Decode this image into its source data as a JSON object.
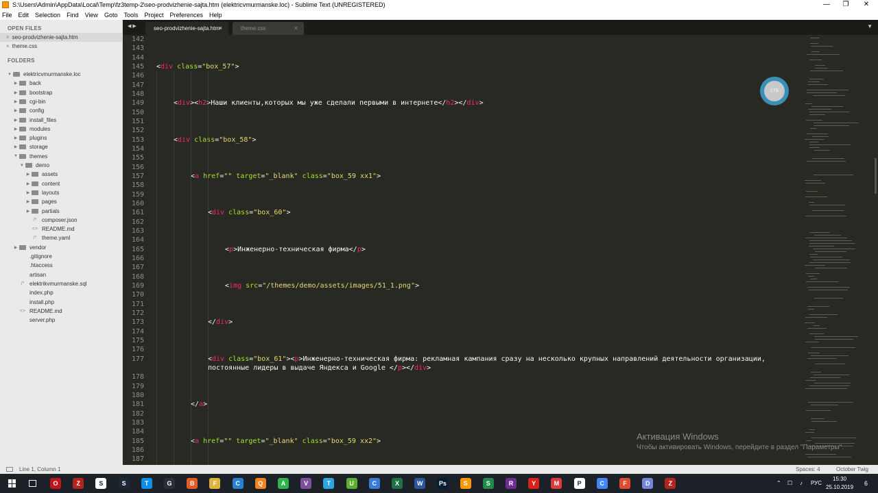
{
  "window": {
    "title": "S:\\Users\\Admin\\AppData\\Local\\Temp\\fz3temp-2\\seo-prodvizhenie-sajta.htm (elektricvmurmanske.loc) - Sublime Text (UNREGISTERED)",
    "minimize": "—",
    "maximize": "❐",
    "close": "✕"
  },
  "menu": [
    "File",
    "Edit",
    "Selection",
    "Find",
    "View",
    "Goto",
    "Tools",
    "Project",
    "Preferences",
    "Help"
  ],
  "sidebar": {
    "open_files_header": "OPEN FILES",
    "open_files": [
      {
        "name": "seo-prodvizhenie-sajta.htm",
        "active": true
      },
      {
        "name": "theme.css",
        "active": false
      }
    ],
    "folders_header": "FOLDERS",
    "tree": [
      {
        "label": "elektricvmurmanske.loc",
        "level": 0,
        "type": "folder",
        "open": true
      },
      {
        "label": "back",
        "level": 1,
        "type": "folder"
      },
      {
        "label": "bootstrap",
        "level": 1,
        "type": "folder"
      },
      {
        "label": "cgi-bin",
        "level": 1,
        "type": "folder"
      },
      {
        "label": "config",
        "level": 1,
        "type": "folder"
      },
      {
        "label": "install_files",
        "level": 1,
        "type": "folder"
      },
      {
        "label": "modules",
        "level": 1,
        "type": "folder"
      },
      {
        "label": "plugins",
        "level": 1,
        "type": "folder"
      },
      {
        "label": "storage",
        "level": 1,
        "type": "folder"
      },
      {
        "label": "themes",
        "level": 1,
        "type": "folder",
        "open": true
      },
      {
        "label": "demo",
        "level": 2,
        "type": "folder",
        "open": true
      },
      {
        "label": "assets",
        "level": 3,
        "type": "folder"
      },
      {
        "label": "content",
        "level": 3,
        "type": "folder"
      },
      {
        "label": "layouts",
        "level": 3,
        "type": "folder"
      },
      {
        "label": "pages",
        "level": 3,
        "type": "folder"
      },
      {
        "label": "partials",
        "level": 3,
        "type": "folder"
      },
      {
        "label": "composer.json",
        "level": 3,
        "type": "file",
        "icon": "/*"
      },
      {
        "label": "README.md",
        "level": 3,
        "type": "file",
        "icon": "<>"
      },
      {
        "label": "theme.yaml",
        "level": 3,
        "type": "file",
        "icon": "/*"
      },
      {
        "label": "vendor",
        "level": 1,
        "type": "folder"
      },
      {
        "label": ".gitignore",
        "level": 1,
        "type": "file",
        "icon": ""
      },
      {
        "label": ".htaccess",
        "level": 1,
        "type": "file",
        "icon": ""
      },
      {
        "label": "artisan",
        "level": 1,
        "type": "file",
        "icon": ""
      },
      {
        "label": "elektrikvmurmanske.sql",
        "level": 1,
        "type": "file",
        "icon": "/*"
      },
      {
        "label": "index.php",
        "level": 1,
        "type": "file",
        "icon": ""
      },
      {
        "label": "install.php",
        "level": 1,
        "type": "file",
        "icon": ""
      },
      {
        "label": "README.md",
        "level": 1,
        "type": "file",
        "icon": "<>"
      },
      {
        "label": "server.php",
        "level": 1,
        "type": "file",
        "icon": ""
      }
    ]
  },
  "tabs": [
    {
      "label": "seo-prodvizhenie-sajta.htm",
      "active": true
    },
    {
      "label": "theme.css",
      "active": false
    }
  ],
  "tab_nav": "◀ ▶",
  "tab_close": "×",
  "tab_dropdown": "▼",
  "code": {
    "lines": [
      {
        "n": "142",
        "segs": []
      },
      {
        "n": "143",
        "segs": []
      },
      {
        "n": "144",
        "segs": []
      },
      {
        "n": "145",
        "indent": 0,
        "segs": [
          [
            "p",
            "<"
          ],
          [
            "t",
            "div"
          ],
          [
            "p",
            " "
          ],
          [
            "a",
            "class"
          ],
          [
            "p",
            "="
          ],
          [
            "s",
            "\"box_57\""
          ],
          [
            "p",
            ">"
          ]
        ]
      },
      {
        "n": "146",
        "segs": []
      },
      {
        "n": "147",
        "segs": []
      },
      {
        "n": "148",
        "segs": []
      },
      {
        "n": "149",
        "indent": 1,
        "segs": [
          [
            "p",
            "<"
          ],
          [
            "t",
            "div"
          ],
          [
            "p",
            "><"
          ],
          [
            "t",
            "h2"
          ],
          [
            "p",
            ">Наши клиенты,которых мы уже сделали первыми в интернете</"
          ],
          [
            "t",
            "h2"
          ],
          [
            "p",
            "></"
          ],
          [
            "t",
            "div"
          ],
          [
            "p",
            ">"
          ]
        ]
      },
      {
        "n": "150",
        "segs": []
      },
      {
        "n": "151",
        "segs": []
      },
      {
        "n": "152",
        "segs": []
      },
      {
        "n": "153",
        "indent": 1,
        "segs": [
          [
            "p",
            "<"
          ],
          [
            "t",
            "div"
          ],
          [
            "p",
            " "
          ],
          [
            "a",
            "class"
          ],
          [
            "p",
            "="
          ],
          [
            "s",
            "\"box_58\""
          ],
          [
            "p",
            ">"
          ]
        ]
      },
      {
        "n": "154",
        "segs": []
      },
      {
        "n": "155",
        "segs": []
      },
      {
        "n": "156",
        "segs": []
      },
      {
        "n": "157",
        "indent": 2,
        "segs": [
          [
            "p",
            "<"
          ],
          [
            "t",
            "a"
          ],
          [
            "p",
            " "
          ],
          [
            "a",
            "href"
          ],
          [
            "p",
            "="
          ],
          [
            "s",
            "\"\""
          ],
          [
            "p",
            " "
          ],
          [
            "a",
            "target"
          ],
          [
            "p",
            "="
          ],
          [
            "s",
            "\"_blank\""
          ],
          [
            "p",
            " "
          ],
          [
            "a",
            "class"
          ],
          [
            "p",
            "="
          ],
          [
            "s",
            "\"box_59 xx1\""
          ],
          [
            "p",
            ">"
          ]
        ]
      },
      {
        "n": "158",
        "segs": []
      },
      {
        "n": "159",
        "segs": []
      },
      {
        "n": "160",
        "segs": []
      },
      {
        "n": "161",
        "indent": 3,
        "segs": [
          [
            "p",
            "<"
          ],
          [
            "t",
            "div"
          ],
          [
            "p",
            " "
          ],
          [
            "a",
            "class"
          ],
          [
            "p",
            "="
          ],
          [
            "s",
            "\"box_60\""
          ],
          [
            "p",
            ">"
          ]
        ]
      },
      {
        "n": "162",
        "segs": []
      },
      {
        "n": "163",
        "segs": []
      },
      {
        "n": "164",
        "segs": []
      },
      {
        "n": "165",
        "indent": 4,
        "segs": [
          [
            "p",
            "<"
          ],
          [
            "t",
            "p"
          ],
          [
            "p",
            ">Инженерно-техническая фирма</"
          ],
          [
            "t",
            "p"
          ],
          [
            "p",
            ">"
          ]
        ]
      },
      {
        "n": "166",
        "segs": []
      },
      {
        "n": "167",
        "segs": []
      },
      {
        "n": "168",
        "segs": []
      },
      {
        "n": "169",
        "indent": 4,
        "segs": [
          [
            "p",
            "<"
          ],
          [
            "t",
            "img"
          ],
          [
            "p",
            " "
          ],
          [
            "a",
            "src"
          ],
          [
            "p",
            "="
          ],
          [
            "s",
            "\"/themes/demo/assets/images/51_1.png\""
          ],
          [
            "p",
            ">"
          ]
        ]
      },
      {
        "n": "170",
        "segs": []
      },
      {
        "n": "171",
        "segs": []
      },
      {
        "n": "172",
        "segs": []
      },
      {
        "n": "173",
        "indent": 3,
        "segs": [
          [
            "p",
            "</"
          ],
          [
            "t",
            "div"
          ],
          [
            "p",
            ">"
          ]
        ]
      },
      {
        "n": "174",
        "segs": []
      },
      {
        "n": "175",
        "segs": []
      },
      {
        "n": "176",
        "segs": []
      },
      {
        "n": "177",
        "indent": 3,
        "segs": [
          [
            "p",
            "<"
          ],
          [
            "t",
            "div"
          ],
          [
            "p",
            " "
          ],
          [
            "a",
            "class"
          ],
          [
            "p",
            "="
          ],
          [
            "s",
            "\"box_61\""
          ],
          [
            "p",
            "><"
          ],
          [
            "t",
            "p"
          ],
          [
            "p",
            ">Инженерно-техническая фирма: рекламная кампания сразу на несколько крупных направлений деятельности организации,"
          ]
        ]
      },
      {
        "n": "",
        "indent": 3,
        "segs": [
          [
            "p",
            "постоянные лидеры в выдаче Яндекса и Google </"
          ],
          [
            "t",
            "p"
          ],
          [
            "p",
            "></"
          ],
          [
            "t",
            "div"
          ],
          [
            "p",
            ">"
          ]
        ]
      },
      {
        "n": "178",
        "segs": []
      },
      {
        "n": "179",
        "segs": []
      },
      {
        "n": "180",
        "segs": []
      },
      {
        "n": "181",
        "indent": 2,
        "segs": [
          [
            "p",
            "</"
          ],
          [
            "t",
            "a"
          ],
          [
            "p",
            ">"
          ]
        ]
      },
      {
        "n": "182",
        "segs": []
      },
      {
        "n": "183",
        "segs": []
      },
      {
        "n": "184",
        "segs": []
      },
      {
        "n": "185",
        "indent": 2,
        "segs": [
          [
            "p",
            "<"
          ],
          [
            "t",
            "a"
          ],
          [
            "p",
            " "
          ],
          [
            "a",
            "href"
          ],
          [
            "p",
            "="
          ],
          [
            "s",
            "\"\""
          ],
          [
            "p",
            " "
          ],
          [
            "a",
            "target"
          ],
          [
            "p",
            "="
          ],
          [
            "s",
            "\"_blank\""
          ],
          [
            "p",
            " "
          ],
          [
            "a",
            "class"
          ],
          [
            "p",
            "="
          ],
          [
            "s",
            "\"box_59 xx2\""
          ],
          [
            "p",
            ">"
          ]
        ]
      },
      {
        "n": "186",
        "segs": []
      },
      {
        "n": "187",
        "segs": []
      }
    ]
  },
  "mem_widget": "2 ГБ",
  "activation": {
    "title": "Активация Windows",
    "subtitle": "Чтобы активировать Windows, перейдите в раздел \"Параметры\"."
  },
  "statusbar": {
    "position": "Line 1, Column 1",
    "spaces": "Spaces: 4",
    "syntax": "October Twig"
  },
  "taskbar": {
    "lang": "РУС",
    "time": "15:30",
    "date": "25.10.2019",
    "notif": "6",
    "icons": [
      {
        "name": "opera-icon",
        "color": "#c0151b",
        "glyph": "O"
      },
      {
        "name": "filezilla-icon",
        "color": "#b3231f",
        "glyph": "Z"
      },
      {
        "name": "search-app-icon",
        "color": "#ffffff",
        "glyph": "S"
      },
      {
        "name": "steam-icon",
        "color": "#1b2838",
        "glyph": "S"
      },
      {
        "name": "teamviewer-icon",
        "color": "#0e8ee9",
        "glyph": "T"
      },
      {
        "name": "gamepad-icon",
        "color": "#2b2f36",
        "glyph": "G"
      },
      {
        "name": "browser-icon",
        "color": "#e15b27",
        "glyph": "B"
      },
      {
        "name": "folder-icon",
        "color": "#e2b33c",
        "glyph": "F"
      },
      {
        "name": "chromium-icon",
        "color": "#2a7fd4",
        "glyph": "C"
      },
      {
        "name": "search-icon",
        "color": "#f18420",
        "glyph": "Q"
      },
      {
        "name": "app-green-icon",
        "color": "#2fb34a",
        "glyph": "A"
      },
      {
        "name": "viber-icon",
        "color": "#7b519d",
        "glyph": "V"
      },
      {
        "name": "telegram-icon",
        "color": "#2ca5e0",
        "glyph": "T"
      },
      {
        "name": "utorrent-icon",
        "color": "#5bb12f",
        "glyph": "U"
      },
      {
        "name": "clock-app-icon",
        "color": "#3a7bd5",
        "glyph": "C"
      },
      {
        "name": "excel-icon",
        "color": "#207245",
        "glyph": "X"
      },
      {
        "name": "word-icon",
        "color": "#2b579a",
        "glyph": "W"
      },
      {
        "name": "photoshop-icon",
        "color": "#001e36",
        "glyph": "Ps"
      },
      {
        "name": "sublime-icon",
        "color": "#ff9800",
        "glyph": "S"
      },
      {
        "name": "s-app-icon",
        "color": "#1f8a4c",
        "glyph": "S"
      },
      {
        "name": "winrar-icon",
        "color": "#6f2c91",
        "glyph": "R"
      },
      {
        "name": "yandex-icon",
        "color": "#d8221c",
        "glyph": "Y"
      },
      {
        "name": "media-icon",
        "color": "#d93c3c",
        "glyph": "M"
      },
      {
        "name": "paw-icon",
        "color": "#ffffff",
        "glyph": "P"
      },
      {
        "name": "chrome-icon",
        "color": "#4285f4",
        "glyph": "C"
      },
      {
        "name": "ftp-icon",
        "color": "#e04c2f",
        "glyph": "F"
      },
      {
        "name": "discord-icon",
        "color": "#7289da",
        "glyph": "D"
      },
      {
        "name": "filezilla2-icon",
        "color": "#b3231f",
        "glyph": "Z"
      }
    ]
  }
}
